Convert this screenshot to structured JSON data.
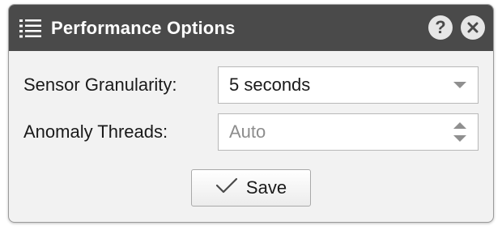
{
  "dialog": {
    "title": "Performance Options",
    "menu_icon": "list-icon",
    "help_label": "?",
    "close_label": "✕"
  },
  "form": {
    "granularity": {
      "label": "Sensor Granularity:",
      "value": "5 seconds"
    },
    "threads": {
      "label": "Anomaly Threads:",
      "placeholder": "Auto"
    }
  },
  "actions": {
    "save_label": "Save",
    "save_icon": "check-icon"
  },
  "colors": {
    "titlebar": "#4a4a4a",
    "body": "#f2f2f2",
    "icon_grey": "#8f8f8f"
  }
}
